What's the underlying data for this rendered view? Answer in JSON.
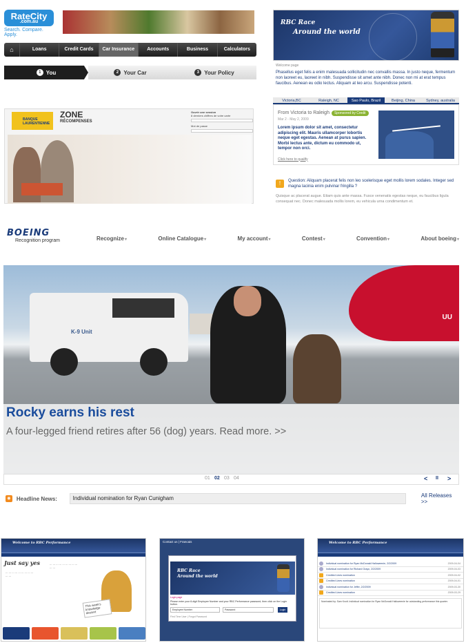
{
  "ratecity": {
    "logo": "RateCity",
    "logo_domain": ".com.au",
    "tagline": "Search. Compare. Apply.",
    "nav": [
      "Loans",
      "Credit Cards",
      "Car Insurance",
      "Accounts",
      "Business",
      "Calculators"
    ],
    "active_nav": "Car Insurance",
    "steps": [
      {
        "num": "1",
        "label": "You"
      },
      {
        "num": "2",
        "label": "Your Car"
      },
      {
        "num": "3",
        "label": "Your Policy"
      }
    ]
  },
  "rbc_race": {
    "title_line1": "RBC Race",
    "title_line2": "Around the world",
    "welcome": "Welcome page",
    "intro": "Phasellus eget felis a enim malesuada sollicitudin nec convallis massa. In justo neque, fermentum non laoreet eu, laoreet in nibh. Suspendisse sit amet ante nibh. Donec non mi at erat tempus faucibus. Aenean eu odio lectus. Aliquam at leo arcu. Suspendisse potenti.",
    "tabs": [
      "Victoria,BC",
      "Raleigh, NC",
      "Sao Paulo, Brazil",
      "Beijing, China",
      "Sydney, australia"
    ],
    "active_tab": "Sao Paulo, Brazil",
    "route": "From Victoria to Raleigh",
    "sponsor": "Sponsored by Credit",
    "dates": "Mar 2 - May 2, 2009",
    "route_text": "Lorem ipsum dolor sit amet, consectetur adipiscing elit. Mauris ullamcorper lobortis neque eget egestas. Aenean at purus sapien. Morbi lectus ante, dictum eu commodo ut, tempor non orci.",
    "qualify_link": "Click here to qualify",
    "question": "Question: Aliquam placerat felis non leo scelerisque eget mollis lorem sodales. Integer sed magna lacinia enim pulvinar fringilla ?",
    "question_body": "Quisque ac placerat augue. Etiam quis ante massa. Fusce venenatis egestas neque, eu faucibus ligula consequat nec. Donec malesuada mollis lorem, eu vehicula urna condimentum et."
  },
  "banque": {
    "logo": "BANQUE LAURENTIENNE",
    "zone_title": "ZONE",
    "zone_sub": "RÉCOMPENSES",
    "login_title": "Ouvrir une session",
    "login_hint": "8 derniers chiffres de votre carte",
    "password_label": "Mot de passe",
    "forgot": "Vous n'êtes pas inscrit ? Mot de passe oublié ?"
  },
  "boeing": {
    "logo": "BOEING",
    "program": "Recognition program",
    "nav": [
      "Recognize",
      "Online Catalogue",
      "My account",
      "Contest",
      "Convention",
      "About boeing"
    ],
    "truck_label": "K-9 Unit",
    "plane_label": "UU",
    "headline": "Rocky earns his rest",
    "subline": "A four-legged friend retires after 56 (dog) years. Read more. >>",
    "pages": [
      "01",
      "02",
      "03",
      "04"
    ],
    "active_page": "02",
    "controls": {
      "prev": "<",
      "pause": "II",
      "next": ">"
    },
    "news_label": "Headline News:",
    "news_item": "Individual nomination for Ryan Cunigham",
    "all_releases": "All Releases >>"
  },
  "thumb1": {
    "header": "Welcome to RBC Performance",
    "heading": "Just say yes",
    "note": "This week's knowledge dessert"
  },
  "thumb2": {
    "top": "Contact us | Francais",
    "banner_line1": "RBC Race",
    "banner_line2": "Around the world",
    "login": "Login page",
    "hint": "Please enter your 8-digit Employee Number and your RBC Performance password, then click on the Login button.",
    "employee_field": "Employee Number",
    "password_field": "Password",
    "login_button": "Login",
    "forgot": "First Time User | Forgot Password"
  },
  "thumb3": {
    "header": "Welcome to RBC Performance",
    "rows": [
      {
        "text": "Individual nomination for Ryan McDonald Halloweenie, 2/2/2009",
        "date": "2009-04-04"
      },
      {
        "text": "Individual nomination for Richard Grayn, 2/2/2009",
        "date": "2009-04-03"
      },
      {
        "text": "Credited Lines nomination",
        "date": "2009-04-02"
      },
      {
        "text": "Credited Lines nomination",
        "date": "2009-04-01"
      },
      {
        "text": "Individual nomination for Jeffer, 2/2/2009",
        "date": "2009-03-30"
      },
      {
        "text": "Credited Lines nomination",
        "date": "2009-03-29"
      }
    ],
    "detail": "Nominated by: Sam Knott. Individual nomination for Ryan McDonald Halloweenie for outstanding performance this quarter."
  },
  "colors": {
    "rbc_blue": "#1a3b7a",
    "boeing_blue": "#1a4c9c",
    "ratecity_blue": "#2a8fd8",
    "sponsor_green": "#8ab332",
    "rss_orange": "#f28a1d"
  }
}
